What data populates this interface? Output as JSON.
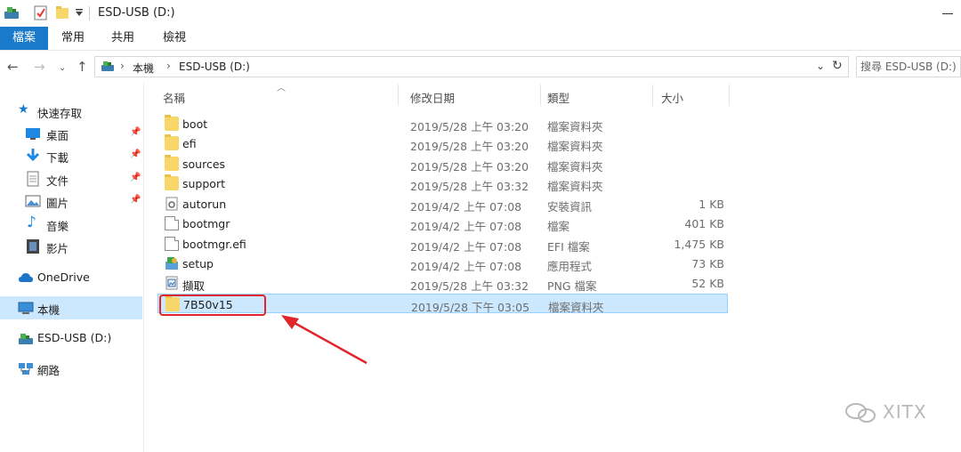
{
  "window": {
    "title": "ESD-USB (D:)"
  },
  "ribbon": {
    "tabs": [
      "檔案",
      "常用",
      "共用",
      "檢視"
    ]
  },
  "address_bar": {
    "crumbs": [
      "本機",
      "ESD-USB (D:)"
    ],
    "search_placeholder": "搜尋 ESD-USB (D:)"
  },
  "navigation": {
    "items": [
      {
        "label": "快速存取",
        "icon": "star-icon"
      },
      {
        "label": "桌面",
        "icon": "desktop-icon",
        "pinned": true
      },
      {
        "label": "下載",
        "icon": "download-icon",
        "pinned": true
      },
      {
        "label": "文件",
        "icon": "documents-icon",
        "pinned": true
      },
      {
        "label": "圖片",
        "icon": "pictures-icon",
        "pinned": true
      },
      {
        "label": "音樂",
        "icon": "music-icon"
      },
      {
        "label": "影片",
        "icon": "videos-icon"
      },
      {
        "label": "OneDrive",
        "icon": "cloud-icon"
      },
      {
        "label": "本機",
        "icon": "computer-icon",
        "selected": true
      },
      {
        "label": "ESD-USB (D:)",
        "icon": "usb-drive-icon"
      },
      {
        "label": "網路",
        "icon": "network-icon"
      }
    ]
  },
  "columns": {
    "name": "名稱",
    "modified": "修改日期",
    "type": "類型",
    "size": "大小"
  },
  "files": [
    {
      "name": "boot",
      "modified": "2019/5/28 上午 03:20",
      "type": "檔案資料夾",
      "size": "",
      "icon": "folder-icon"
    },
    {
      "name": "efi",
      "modified": "2019/5/28 上午 03:20",
      "type": "檔案資料夾",
      "size": "",
      "icon": "folder-icon"
    },
    {
      "name": "sources",
      "modified": "2019/5/28 上午 03:20",
      "type": "檔案資料夾",
      "size": "",
      "icon": "folder-icon"
    },
    {
      "name": "support",
      "modified": "2019/5/28 上午 03:32",
      "type": "檔案資料夾",
      "size": "",
      "icon": "folder-icon"
    },
    {
      "name": "autorun",
      "modified": "2019/4/2 上午 07:08",
      "type": "安裝資訊",
      "size": "1 KB",
      "icon": "setup-info-icon"
    },
    {
      "name": "bootmgr",
      "modified": "2019/4/2 上午 07:08",
      "type": "檔案",
      "size": "401 KB",
      "icon": "file-icon"
    },
    {
      "name": "bootmgr.efi",
      "modified": "2019/4/2 上午 07:08",
      "type": "EFI 檔案",
      "size": "1,475 KB",
      "icon": "file-icon"
    },
    {
      "name": "setup",
      "modified": "2019/4/2 上午 07:08",
      "type": "應用程式",
      "size": "73 KB",
      "icon": "setup-app-icon"
    },
    {
      "name": "擷取",
      "modified": "2019/5/28 上午 03:32",
      "type": "PNG 檔案",
      "size": "52 KB",
      "icon": "image-file-icon"
    },
    {
      "name": "7B50v15",
      "modified": "2019/5/28 下午 03:05",
      "type": "檔案資料夾",
      "size": "",
      "icon": "folder-icon",
      "selected": true
    }
  ],
  "watermark": "XITX",
  "colors": {
    "accent": "#1979ca",
    "selection": "#cce8ff",
    "annotation": "#e0262a"
  }
}
